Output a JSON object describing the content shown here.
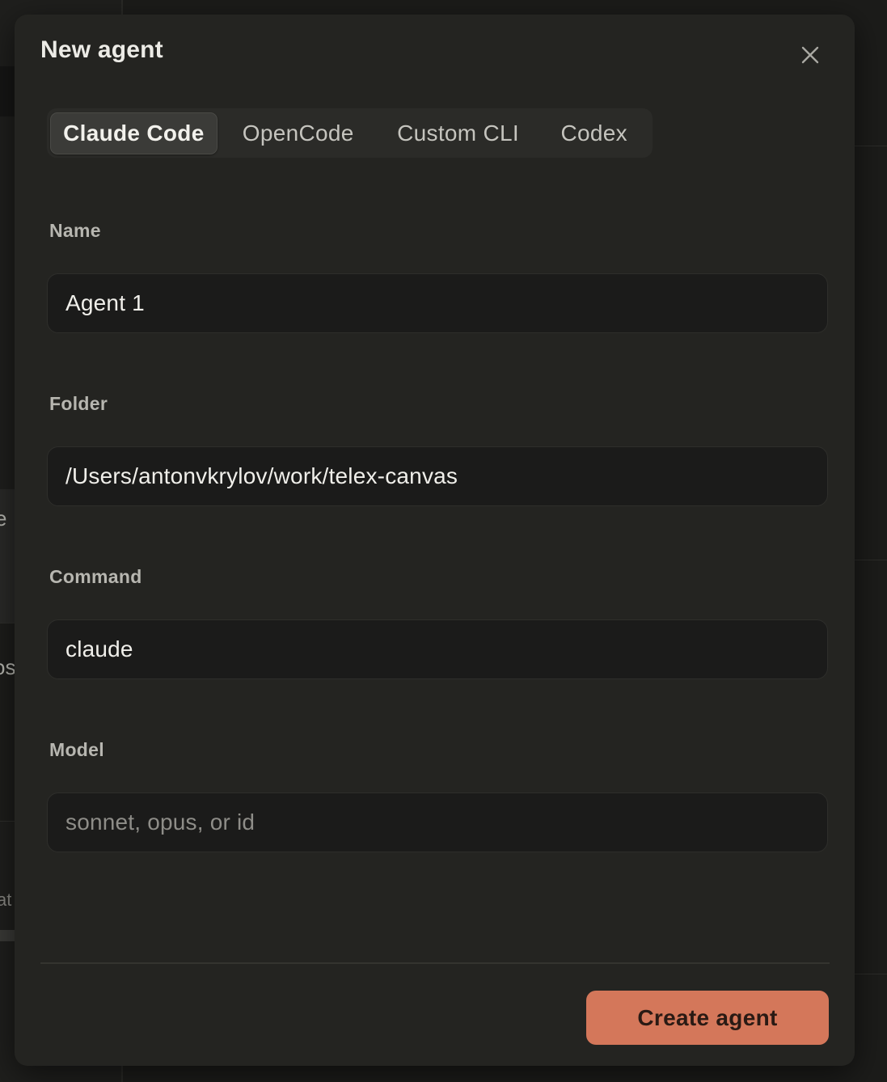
{
  "background": {
    "fragments": [
      "e",
      "os",
      "at"
    ]
  },
  "modal": {
    "title": "New agent",
    "close_icon": "close-icon"
  },
  "tabs": [
    {
      "label": "Claude Code",
      "active": true
    },
    {
      "label": "OpenCode",
      "active": false
    },
    {
      "label": "Custom CLI",
      "active": false
    },
    {
      "label": "Codex",
      "active": false
    }
  ],
  "fields": {
    "name": {
      "label": "Name",
      "value": "Agent 1",
      "placeholder": ""
    },
    "folder": {
      "label": "Folder",
      "value": "/Users/antonvkrylov/work/telex-canvas",
      "placeholder": ""
    },
    "command": {
      "label": "Command",
      "value": "claude",
      "placeholder": ""
    },
    "model": {
      "label": "Model",
      "value": "",
      "placeholder": "sonnet, opus, or id"
    }
  },
  "actions": {
    "create_label": "Create agent"
  },
  "colors": {
    "accent": "#d4775a",
    "modal_bg": "#242421",
    "input_bg": "#1b1b1a"
  }
}
